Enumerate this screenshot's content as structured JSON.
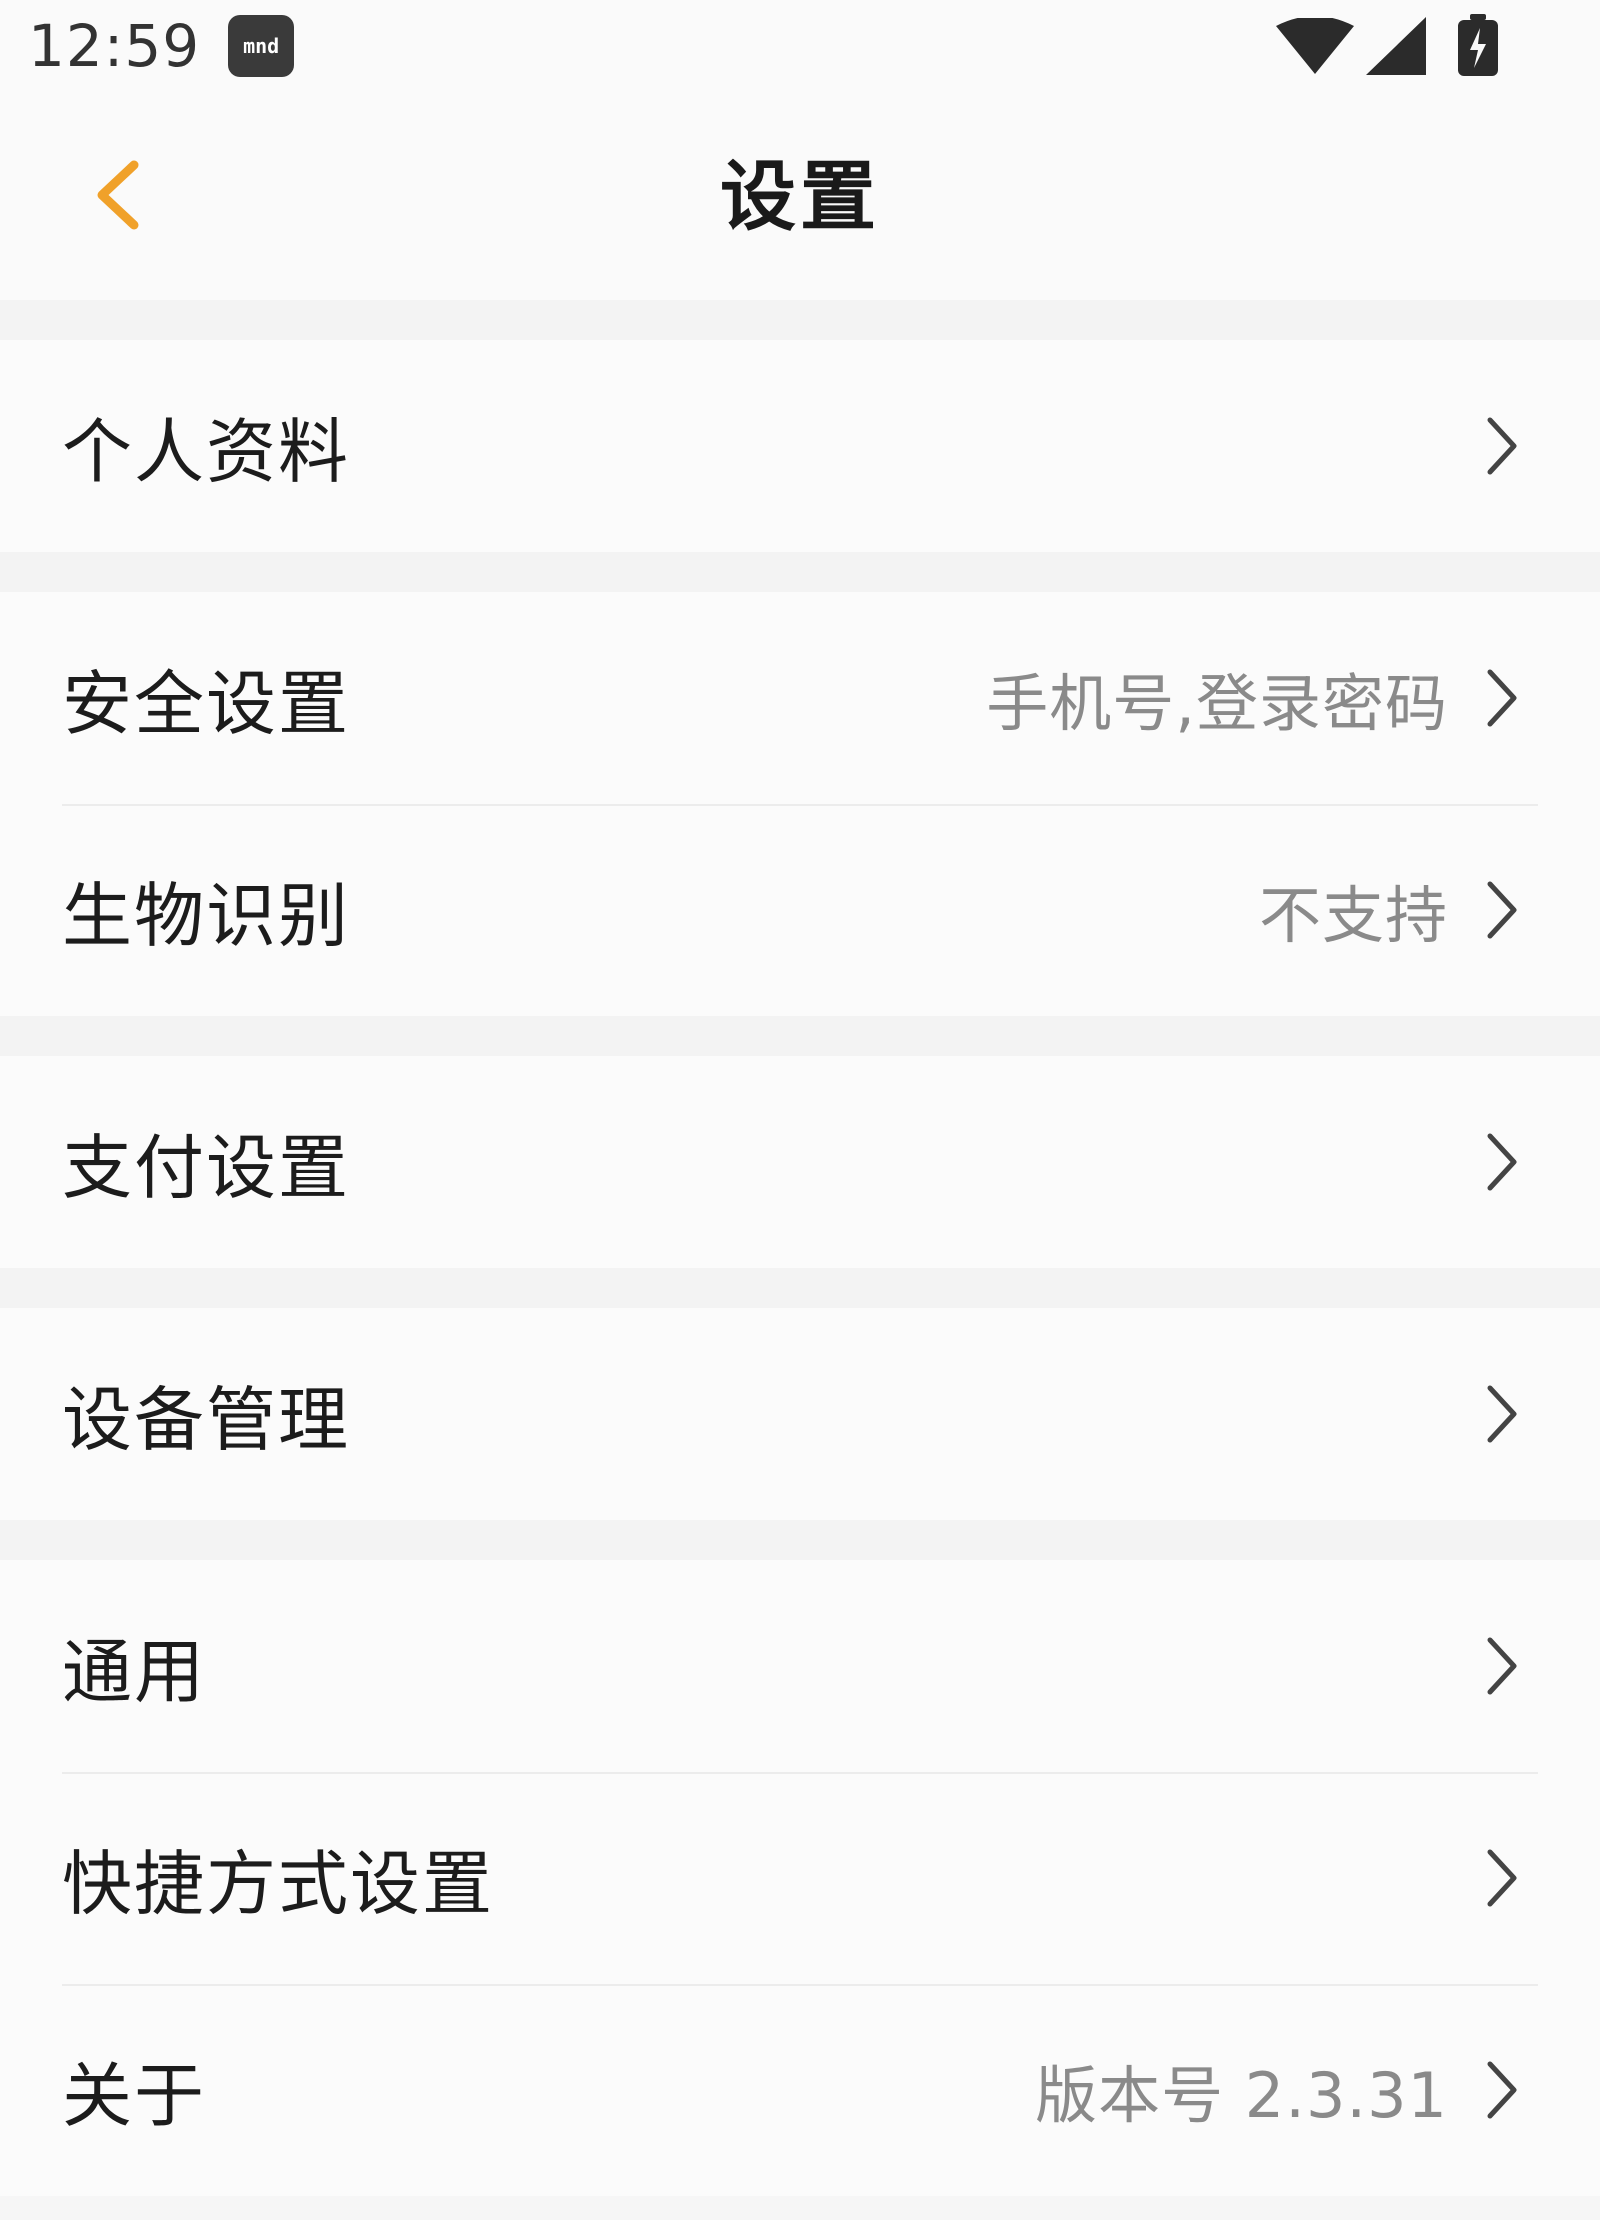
{
  "status_bar": {
    "time": "12:59",
    "notification_badge": "mnd"
  },
  "header": {
    "title": "设置",
    "back_icon": "chevron-left-icon",
    "accent_color": "#f0a12a"
  },
  "groups": [
    {
      "items": [
        {
          "label": "个人资料",
          "value": ""
        }
      ]
    },
    {
      "items": [
        {
          "label": "安全设置",
          "value": "手机号,登录密码"
        },
        {
          "label": "生物识别",
          "value": "不支持"
        }
      ]
    },
    {
      "items": [
        {
          "label": "支付设置",
          "value": ""
        }
      ]
    },
    {
      "items": [
        {
          "label": "设备管理",
          "value": ""
        }
      ]
    },
    {
      "items": [
        {
          "label": "通用",
          "value": ""
        },
        {
          "label": "快捷方式设置",
          "value": ""
        },
        {
          "label": "关于",
          "value": "版本号 2.3.31"
        }
      ]
    }
  ]
}
